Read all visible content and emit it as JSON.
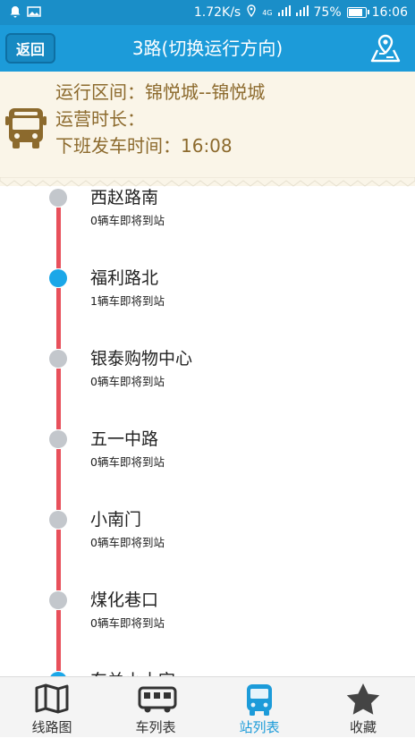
{
  "status_bar": {
    "net_speed": "1.72K/s",
    "network": "4G",
    "battery": "75%",
    "time": "16:06"
  },
  "header": {
    "back_label": "返回",
    "title": "3路(切换运行方向)",
    "map_icon": "map-location-icon"
  },
  "info": {
    "route_range": "运行区间：锦悦城--锦悦城",
    "operating_hours": "运营时长：",
    "last_departure": "下班发车时间：16:08",
    "icon": "bus-icon"
  },
  "stations": [
    {
      "name": "西赵路南",
      "status": "0辆车即将到站",
      "current": false
    },
    {
      "name": "福利路北",
      "status": "1辆车即将到站",
      "current": true
    },
    {
      "name": "银泰购物中心",
      "status": "0辆车即将到站",
      "current": false
    },
    {
      "name": "五一中路",
      "status": "0辆车即将到站",
      "current": false
    },
    {
      "name": "小南门",
      "status": "0辆车即将到站",
      "current": false
    },
    {
      "name": "煤化巷口",
      "status": "0辆车即将到站",
      "current": false
    },
    {
      "name": "东关小十字",
      "status": "",
      "current": true
    }
  ],
  "tabs": [
    {
      "label": "线路图",
      "icon": "route-map-icon",
      "active": false
    },
    {
      "label": "车列表",
      "icon": "bus-list-icon",
      "active": false
    },
    {
      "label": "站列表",
      "icon": "station-list-icon",
      "active": true
    },
    {
      "label": "收藏",
      "icon": "star-icon",
      "active": false
    }
  ],
  "colors": {
    "accent": "#1c9bd9",
    "route_line": "#e8505b",
    "info_text": "#8c6a2d",
    "current_dot": "#1ba7e8",
    "other_dot": "#c3c7cc"
  }
}
